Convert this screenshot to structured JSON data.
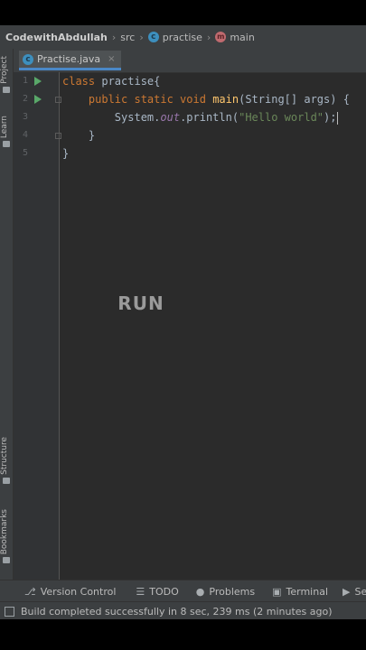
{
  "breadcrumb": {
    "project": "CodewithAbdullah",
    "folder": "src",
    "class_name": "practise",
    "method": "main",
    "class_icon_glyph": "c",
    "method_icon_glyph": "m"
  },
  "side_tabs": {
    "project": "Project",
    "learn": "Learn",
    "structure": "Structure",
    "bookmarks": "Bookmarks"
  },
  "editor_tab": {
    "filename": "Practise.java",
    "close_glyph": "×"
  },
  "gutter": {
    "line_numbers": [
      "1",
      "2",
      "3",
      "4",
      "5"
    ]
  },
  "code": {
    "line1": {
      "kw": "class",
      "name": " practise{"
    },
    "line2": {
      "indent": "    ",
      "kw": "public static void",
      "sp": " ",
      "fn": "main",
      "rest": "(String[] args) {"
    },
    "line3": {
      "indent": "        ",
      "pre": "System.",
      "field": "out",
      "mid": ".println(",
      "str": "\"Hello world\"",
      "end": ");"
    },
    "line4": {
      "text": "    }"
    },
    "line5": {
      "text": "}"
    }
  },
  "overlay_text": "RUN",
  "bottom_tools": {
    "version_control": "Version Control",
    "todo": "TODO",
    "problems": "Problems",
    "terminal": "Terminal",
    "services": "Services"
  },
  "status": {
    "message": "Build completed successfully in 8 sec, 239 ms (2 minutes ago)"
  },
  "colors": {
    "keyword": "#cc7832",
    "method": "#ffc66d",
    "string": "#6a8759",
    "field": "#9876aa",
    "run_icon": "#59a869",
    "tab_accent": "#4a88c7"
  }
}
